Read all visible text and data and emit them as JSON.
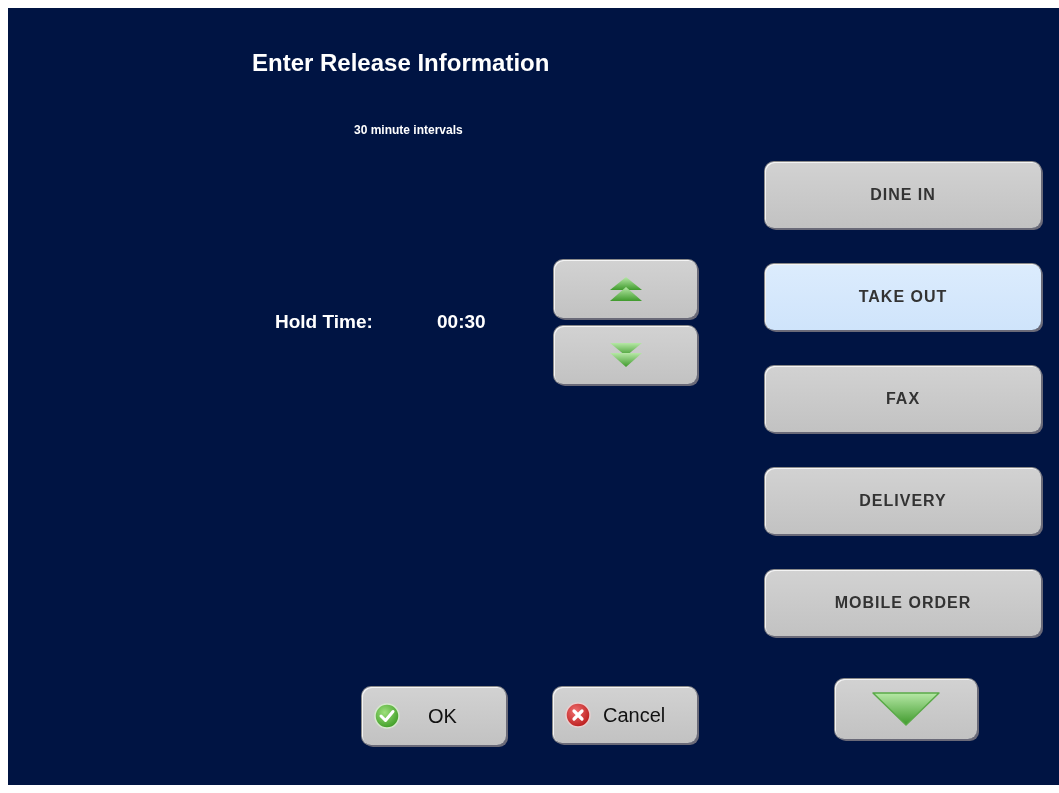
{
  "window": {
    "title": "Enter Release Information",
    "subtitle": "30 minute intervals"
  },
  "hold_time": {
    "label": "Hold Time:",
    "value": "00:30"
  },
  "order_types": [
    {
      "label": "DINE IN",
      "selected": false
    },
    {
      "label": "TAKE OUT",
      "selected": true
    },
    {
      "label": "FAX",
      "selected": false
    },
    {
      "label": "DELIVERY",
      "selected": false
    },
    {
      "label": "MOBILE ORDER",
      "selected": false
    }
  ],
  "buttons": [
    {
      "kind": "ok",
      "label": "OK"
    },
    {
      "kind": "cancel",
      "label": "Cancel"
    }
  ]
}
